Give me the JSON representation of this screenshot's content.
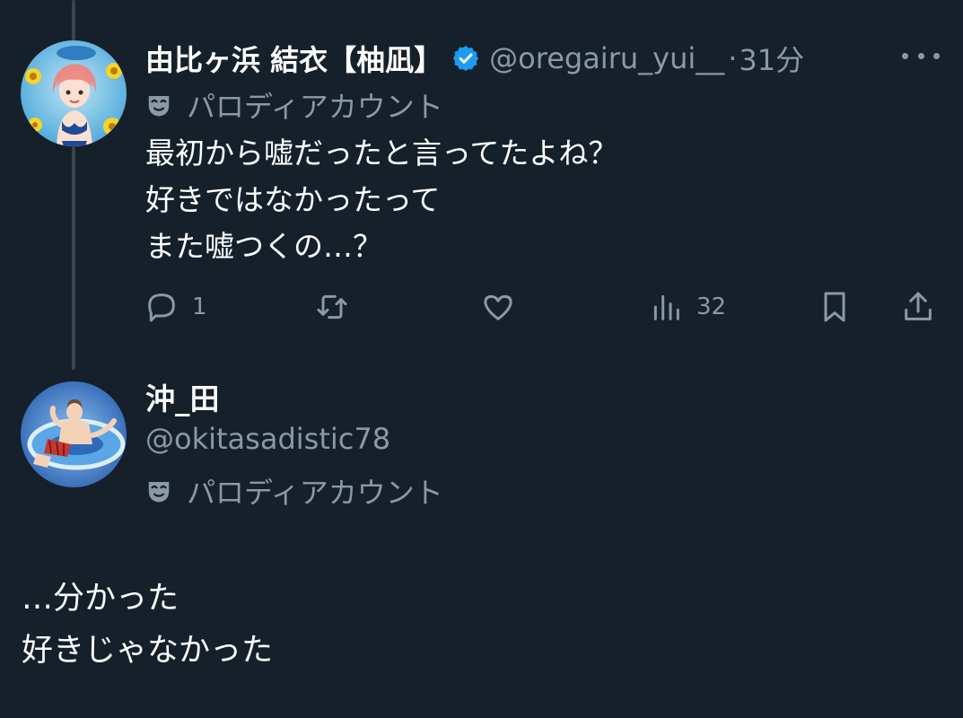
{
  "tweet": {
    "author": {
      "display_name": "由比ヶ浜 結衣【柚凪】",
      "handle": "@oregairu_yui__",
      "separator": "·",
      "time": "31分",
      "verified": true,
      "parody_label": "パロディアカウント",
      "avatar": "anime-girl-swimsuit-avatar"
    },
    "text_lines": [
      "最初から嘘だったと言ってたよね？",
      "好きではなかったって",
      "また嘘つくの…？"
    ],
    "actions": {
      "reply_count": "1",
      "retweet_count": "",
      "like_count": "",
      "view_count": "32"
    },
    "icons": {
      "reply": "reply-icon",
      "retweet": "retweet-icon",
      "like": "heart-icon",
      "views": "views-icon",
      "bookmark": "bookmark-icon",
      "share": "share-icon",
      "more": "more-dots-icon",
      "verified": "verified-badge-icon",
      "parody": "parody-mask-icon"
    }
  },
  "reply": {
    "author": {
      "display_name": "沖_田",
      "handle": "@okitasadistic78",
      "parody_label": "パロディアカウント",
      "avatar": "anime-boy-pool-float-avatar"
    },
    "text_lines": [
      "…分かった",
      "好きじゃなかった"
    ]
  },
  "colors": {
    "background": "#15202b",
    "text_primary": "#ffffff",
    "text_secondary": "#8b98a5",
    "verified_blue": "#1d9bf0",
    "thread_line": "#38444d"
  }
}
